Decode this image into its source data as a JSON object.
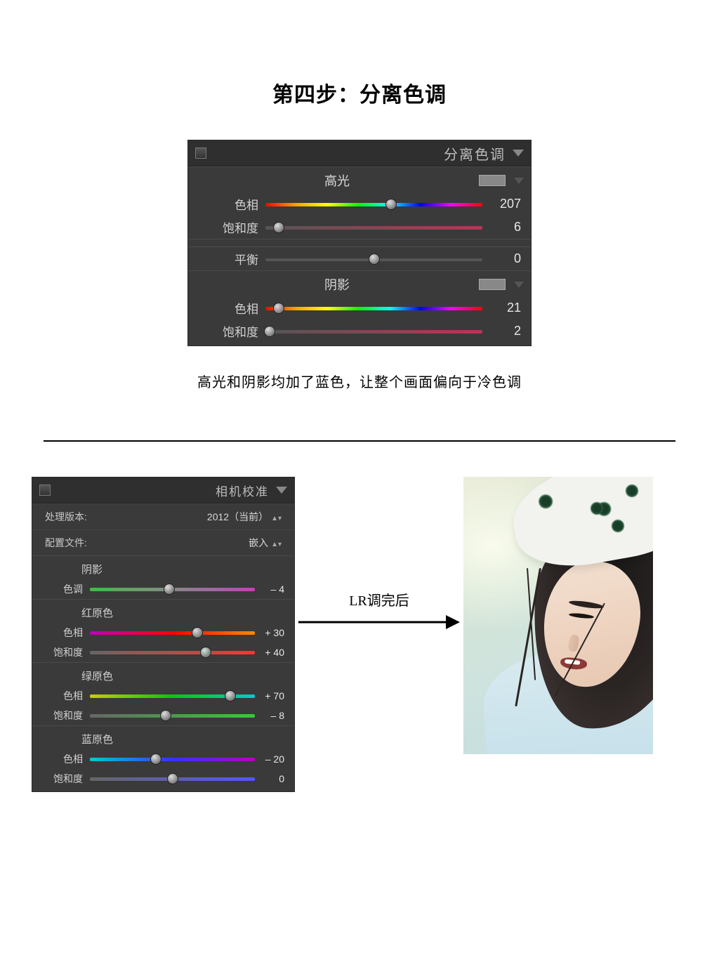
{
  "title": "第四步：分离色调",
  "caption": "高光和阴影均加了蓝色，让整个画面偏向于冷色调",
  "panel1": {
    "header": "分离色调",
    "highlights": {
      "section_label": "高光",
      "hue_label": "色相",
      "hue_value": "207",
      "sat_label": "饱和度",
      "sat_value": "6"
    },
    "balance": {
      "label": "平衡",
      "value": "0"
    },
    "shadows": {
      "section_label": "阴影",
      "hue_label": "色相",
      "hue_value": "21",
      "sat_label": "饱和度",
      "sat_value": "2"
    }
  },
  "panel2": {
    "header": "相机校准",
    "process_label": "处理版本:",
    "process_value": "2012（当前）",
    "profile_label": "配置文件:",
    "profile_value": "嵌入",
    "shadow": {
      "section_label": "阴影",
      "tint_label": "色调",
      "tint_value": "– 4"
    },
    "red": {
      "section_label": "红原色",
      "hue_label": "色相",
      "hue_value": "+ 30",
      "sat_label": "饱和度",
      "sat_value": "+ 40"
    },
    "green": {
      "section_label": "绿原色",
      "hue_label": "色相",
      "hue_value": "+ 70",
      "sat_label": "饱和度",
      "sat_value": "– 8"
    },
    "blue": {
      "section_label": "蓝原色",
      "hue_label": "色相",
      "hue_value": "– 20",
      "sat_label": "饱和度",
      "sat_value": "0"
    }
  },
  "arrow_label": "LR调完后"
}
